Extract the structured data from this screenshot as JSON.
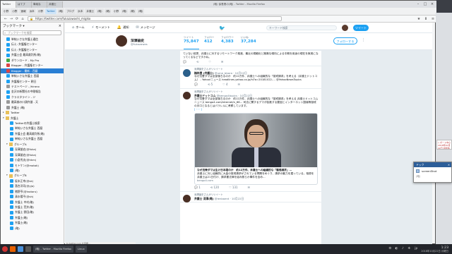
{
  "window": {
    "title": "(略) 保養業の(略) - Twitter - Mozilla Firefox",
    "tabs": [
      "Twitter",
      "はてブ",
      "単純な",
      "弁護士"
    ],
    "controls": [
      "–",
      "□",
      "×"
    ]
  },
  "bookmarks_bar": [
    "小野",
    "小野",
    "速報",
    "浜本",
    "小野",
    "Twitter",
    "(略)",
    "ブログ",
    "浜本",
    "弁護士",
    "(略)",
    "(略)",
    "小野",
    "(略)",
    "(略)",
    "(略)"
  ],
  "navbar": {
    "back": "←",
    "forward": "→",
    "reload": "⟳",
    "home": "⌂",
    "url": "https://twitter.com/fukazawashi_migiko",
    "icons": [
      "★",
      "⬇",
      "≡"
    ]
  },
  "sidebar": {
    "title": "ブックマーク ▾",
    "search_placeholder": "ブックマークを検索",
    "items": [
      {
        "label": "単純いさな弁護士通信",
        "icon": "tw",
        "indent": 1
      },
      {
        "label": "伝え: 弁護権センター",
        "icon": "tw",
        "indent": 1
      },
      {
        "label": "伝え: 弁護権センター",
        "icon": "tw",
        "indent": 1
      },
      {
        "label": "弁護士会 最高裁判所(略)",
        "icon": "tw",
        "indent": 1
      },
      {
        "label": "ダウンロード - My Pro",
        "icon": "grn",
        "indent": 1
      },
      {
        "label": "Blogger - 弁護権センター",
        "icon": "red",
        "indent": 1
      },
      {
        "label": "Blogger - 最新 - 西暦",
        "icon": "red",
        "indent": 1,
        "selected": true
      },
      {
        "label": "単純いさな弁護士 西暦",
        "icon": "tw",
        "indent": 1
      },
      {
        "label": "弁護権センター 朝日",
        "icon": "tw",
        "indent": 1
      },
      {
        "label": "テストページ - /hirano",
        "icon": "gray",
        "indent": 1
      },
      {
        "label": "金沢の新聞社の中間報告",
        "icon": "tw",
        "indent": 1
      },
      {
        "label": "クラスタライン - ジ",
        "icon": "tw",
        "indent": 1
      },
      {
        "label": "最高裁の口頭弁論 - 天",
        "icon": "gray",
        "indent": 1
      },
      {
        "label": "弁護士 (略)",
        "icon": "gray",
        "indent": 1
      },
      {
        "label": "Twitter",
        "icon": "fold",
        "indent": 0,
        "twisty": "▸"
      },
      {
        "label": "弁護士",
        "icon": "fold",
        "indent": 0,
        "twisty": "▾"
      },
      {
        "label": "Twitterの弁護士検索",
        "icon": "tw",
        "indent": 2
      },
      {
        "label": "単純いさな弁護士 西暦",
        "icon": "tw",
        "indent": 2
      },
      {
        "label": "弁護士会 最高裁判所(略)",
        "icon": "tw",
        "indent": 2
      },
      {
        "label": "単純いさな弁護士 西暦",
        "icon": "tw",
        "indent": 2
      },
      {
        "label": "グループA",
        "icon": "fold",
        "indent": 1,
        "twisty": "▾"
      },
      {
        "label": "深澤諭史(@fuka)",
        "icon": "tw",
        "indent": 2
      },
      {
        "label": "深澤諭史(@fuka)",
        "icon": "tw",
        "indent": 2
      },
      {
        "label": "小倉秀夫(@hkm)",
        "icon": "tw",
        "indent": 2
      },
      {
        "label": "モトケン(@motok)",
        "icon": "tw",
        "indent": 2
      },
      {
        "label": "(略)",
        "icon": "tw",
        "indent": 2
      },
      {
        "label": "グループB",
        "icon": "fold",
        "indent": 1,
        "twisty": "▾"
      },
      {
        "label": "坂本正幸(@sk)",
        "icon": "tw",
        "indent": 2
      },
      {
        "label": "落合洋司(@yjo)",
        "icon": "tw",
        "indent": 2
      },
      {
        "label": "猪野亨(@inotoru)",
        "icon": "tw",
        "indent": 2
      },
      {
        "label": "清水陽平(@sh)",
        "icon": "tw",
        "indent": 2
      },
      {
        "label": "弁護士 中村(略)",
        "icon": "tw",
        "indent": 2
      },
      {
        "label": "弁護士 荒井(略)",
        "icon": "tw",
        "indent": 2
      },
      {
        "label": "弁護士 野田(略)",
        "icon": "tw",
        "indent": 2
      },
      {
        "label": "弁護士(略)",
        "icon": "tw",
        "indent": 2
      },
      {
        "label": "弁護士(略)",
        "icon": "tw",
        "indent": 2
      },
      {
        "label": "(略)",
        "icon": "tw",
        "indent": 2
      }
    ]
  },
  "twitter_nav": {
    "items": [
      {
        "icon": "⌂",
        "label": "ホーム"
      },
      {
        "icon": "⚡",
        "label": "モーメント"
      },
      {
        "icon": "🔔",
        "label": "通知"
      },
      {
        "icon": "✉",
        "label": "メッセージ"
      }
    ],
    "search_placeholder": "キーワード検索",
    "tweet_button": "ツイート"
  },
  "profile": {
    "name": "深澤諭史",
    "handle": "@fukazawas",
    "stats": [
      {
        "label": "ツイート",
        "value": "75,847"
      },
      {
        "label": "フォロー",
        "value": "412"
      },
      {
        "label": "フォロワー",
        "value": "4,383"
      },
      {
        "label": "いいね",
        "value": "37,284"
      }
    ],
    "follow_button": "フォローする",
    "more": "⋮"
  },
  "tweets": [
    {
      "retweeted": "",
      "author": "",
      "handle": "",
      "body": "ていない前提、弁護士に対するリモートワーク推進、最近の規範化と撤廃な傾向による中期を用途の現在を無常になってくるなどですかね。",
      "link": "",
      "actions": [
        "💬",
        "⟲",
        "♡",
        "✉"
      ]
    },
    {
      "retweeted": "深澤諭史さんがリツイート",
      "author": "梅林豊 (弁護士)",
      "handle": "@ume_bbara · 10月22日",
      "body": "なぜ法曹ダマは全部落ちるのか　約12万件、弁護士への組織的な「懲戒請求」を考える（弁護士ドットコム） - Yahoo!ニュース headlines.yahoo.co.jp/hl?a=20181022-… @YahooNewsTopics",
      "link": "",
      "actions": [
        "💬",
        "⟲ 5",
        "♡ 4",
        "✉"
      ]
    },
    {
      "retweeted": "深澤諭史さんがリツイート",
      "author": "弁護士ドットコム",
      "handle": "@bengo4topics · 10月22日",
      "body": "なぜ法曹ダマは全部落ちるのか　約12万件、弁護士への組織的な「懲戒請求」を考える 弁護士ドットコムニュース bengo4.com/internet/n_88… 司法に関するデマが拡散する要因とインターネット国境等懲戒の手口となるとはパラレルに考察しています。",
      "link": "[ ･･･ ]",
      "card": {
        "title": "なぜ法律ダマは生け日本語のか　約12万件、弁護士への組織的な「懲戒請求」…",
        "desc": "弁護士に対し組織的に大量の懲戒請求がされている問題をめぐり、請求の動力を掘っている。相原を弁護士は21日付け、請求書法律を組み照らか事件を含め…",
        "url": "bengo4.com"
      },
      "actions": [
        "💬 1",
        "⟲ 120",
        "♡ 131",
        "✉"
      ]
    },
    {
      "retweeted": "深澤諭史さんがリツイート",
      "author": "弁護士 深澤(略)",
      "handle": "@ienbaent · 10月22日",
      "body": "",
      "link": "",
      "actions": []
    }
  ],
  "right_panel": {
    "snippet": "レポート中心 2018年10月22日 最新情報 (略) 1"
  },
  "popup": {
    "title": "ドック",
    "close": "✕",
    "item": "screenShot",
    "sub": "(略)"
  },
  "taskbar": {
    "windows": [
      "(略) - Twitter - Mozilla Firefox",
      "Linux"
    ],
    "tray": [
      "⚙",
      "◐",
      "♪",
      "⎈",
      "jp"
    ],
    "time": "1:23",
    "date": "2018年10月22日 月曜日"
  },
  "statusbar": "tx.twitter.com を待機..."
}
